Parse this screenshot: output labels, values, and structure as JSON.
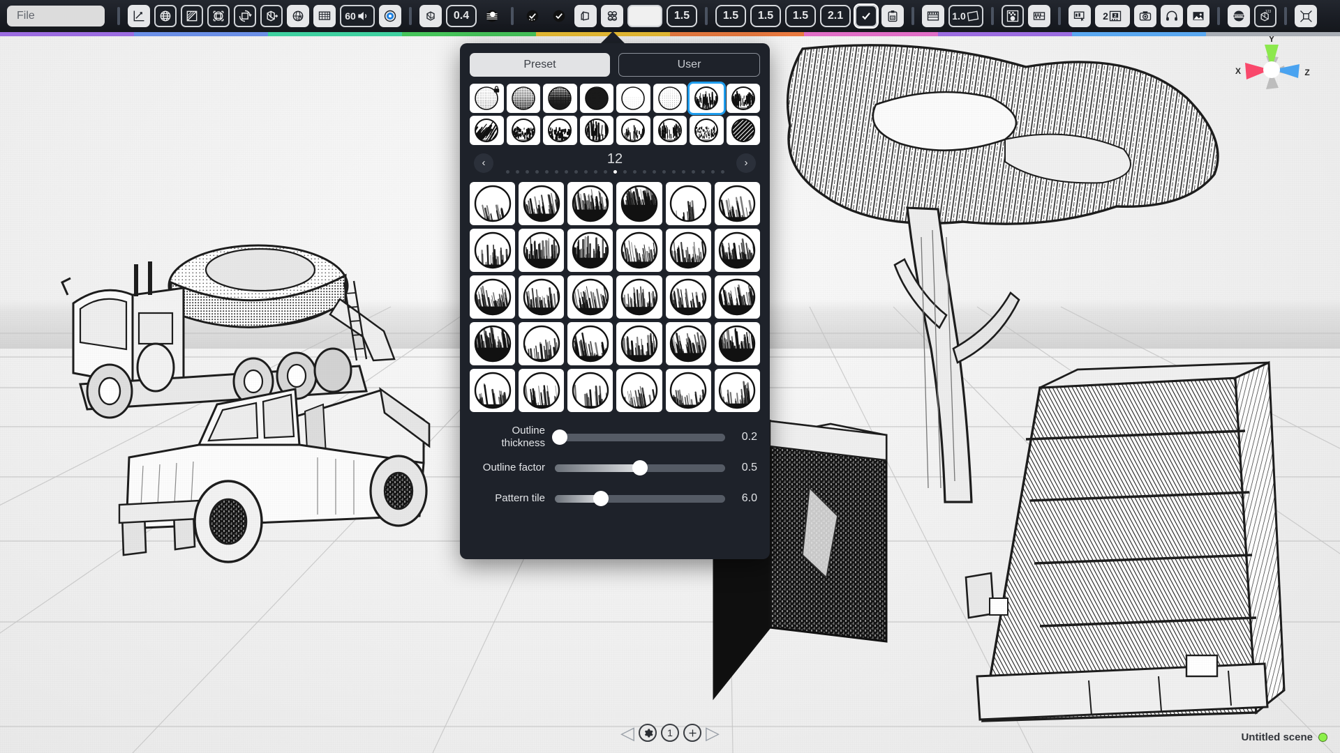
{
  "app": {
    "window_title": "Untitled scene",
    "scene_status_color": "#8cf04a"
  },
  "toolbar": {
    "file_field": {
      "name": "file-field",
      "value": "",
      "placeholder": "File"
    },
    "accent_strip_colors": [
      "#9b6ce0",
      "#6b8fe6",
      "#3fd0a0",
      "#46c45a",
      "#e8bb33",
      "#e8793f",
      "#e06ec6",
      "#9b6ce0",
      "#5aa8f0",
      "#a8adb4"
    ],
    "buttons": [
      {
        "name": "axes-tool-button",
        "icon": "axes-icon",
        "label": "",
        "style": "light"
      },
      {
        "name": "globe-wire-button",
        "icon": "globe-wire-icon",
        "label": "",
        "style": "dark"
      },
      {
        "name": "gradient-square-button",
        "icon": "gradient-square-icon",
        "label": "",
        "style": "dark"
      },
      {
        "name": "bounding-select-button",
        "icon": "bounding-select-icon",
        "label": "",
        "style": "dark"
      },
      {
        "name": "rotate-cube-button",
        "icon": "rotate-cube-icon",
        "label": "",
        "style": "dark"
      },
      {
        "name": "extrude-cube-button",
        "icon": "extrude-cube-icon",
        "label": "",
        "style": "dark"
      },
      {
        "name": "globe-button",
        "icon": "globe-icon",
        "label": "",
        "style": "light"
      },
      {
        "name": "grid-panel-button",
        "icon": "grid-panel-icon",
        "label": "",
        "style": "light"
      },
      {
        "name": "fps-speaker-button",
        "icon": "speaker-icon",
        "label": "60",
        "style": "dark"
      },
      {
        "name": "target-button",
        "icon": "target-icon",
        "label": "",
        "style": "light"
      },
      {
        "name": "cube-button",
        "icon": "cube-icon",
        "label": "",
        "style": "light"
      },
      {
        "name": "opacity-value-button",
        "icon": "",
        "label": "0.4",
        "style": "num"
      },
      {
        "name": "shading-sphere-button",
        "icon": "shading-sphere-icon",
        "label": "",
        "style": "plain"
      },
      {
        "name": "dither-check-button",
        "icon": "dither-check-icon",
        "label": "",
        "style": "plain"
      },
      {
        "name": "check-circle-button",
        "icon": "check-circle-icon",
        "label": "",
        "style": "plain"
      },
      {
        "name": "shape-skew-button",
        "icon": "shape-skew-icon",
        "label": "",
        "style": "light"
      },
      {
        "name": "four-spheres-button",
        "icon": "four-spheres-icon",
        "label": "",
        "style": "light"
      },
      {
        "name": "material-preview-button",
        "icon": "blank-preview-icon",
        "label": "",
        "style": "preview"
      },
      {
        "name": "value-a-button",
        "icon": "",
        "label": "1.5",
        "style": "num"
      },
      {
        "name": "value-b-button",
        "icon": "",
        "label": "1.5",
        "style": "num"
      },
      {
        "name": "value-c-button",
        "icon": "",
        "label": "1.5",
        "style": "num"
      },
      {
        "name": "value-d-button",
        "icon": "",
        "label": "1.5",
        "style": "num"
      },
      {
        "name": "value-e-button",
        "icon": "",
        "label": "2.1",
        "style": "num"
      },
      {
        "name": "confirm-check-button",
        "icon": "check-icon",
        "label": "",
        "style": "check"
      },
      {
        "name": "export-3d-button",
        "icon": "clipboard-3d-icon",
        "label": "",
        "style": "light"
      },
      {
        "name": "filmstrip-button",
        "icon": "filmstrip-icon",
        "label": "",
        "style": "light"
      },
      {
        "name": "zoom-value-button",
        "icon": "banner-icon",
        "label": "1.0",
        "style": "dark"
      },
      {
        "name": "checker-dot-button",
        "icon": "checker-dot-icon",
        "label": "",
        "style": "dark"
      },
      {
        "name": "timeline-button",
        "icon": "timeline-icon",
        "label": "",
        "style": "light"
      },
      {
        "name": "timeline-drag-button",
        "icon": "timeline-drag-icon",
        "label": "",
        "style": "light"
      },
      {
        "name": "frame-2-button",
        "icon": "frame-number-icon",
        "label": "2",
        "style": "light"
      },
      {
        "name": "camera-button",
        "icon": "camera-icon",
        "label": "",
        "style": "light"
      },
      {
        "name": "headphones-button",
        "icon": "headphones-icon",
        "label": "",
        "style": "light"
      },
      {
        "name": "image-button",
        "icon": "image-icon",
        "label": "",
        "style": "light"
      },
      {
        "name": "www-button",
        "icon": "www-globe-icon",
        "label": "",
        "style": "light"
      },
      {
        "name": "cube-123-button",
        "icon": "cube-123-icon",
        "label": "",
        "style": "dark"
      },
      {
        "name": "transform-gizmo-button",
        "icon": "transform-gizmo-icon",
        "label": "",
        "style": "light"
      }
    ]
  },
  "material_panel": {
    "tabs": [
      {
        "name": "tab-preset",
        "label": "Preset",
        "active": true
      },
      {
        "name": "tab-user",
        "label": "User",
        "active": false
      }
    ],
    "top_swatches": [
      {
        "name": "swatch-dot-fine",
        "pattern": "halftone-fine",
        "locked": true,
        "selected": false
      },
      {
        "name": "swatch-dot-medium",
        "pattern": "halftone-medium",
        "selected": false
      },
      {
        "name": "swatch-dot-dense",
        "pattern": "halftone-dense",
        "selected": false
      },
      {
        "name": "swatch-dot-heavy",
        "pattern": "halftone-heavy",
        "selected": false
      },
      {
        "name": "swatch-dot-light",
        "pattern": "halftone-light",
        "selected": false
      },
      {
        "name": "swatch-dot-sparse",
        "pattern": "halftone-sparse",
        "selected": false
      },
      {
        "name": "swatch-brush-grass",
        "pattern": "brush-grass",
        "selected": true
      },
      {
        "name": "swatch-brush-scratch",
        "pattern": "brush-scratch",
        "selected": false
      },
      {
        "name": "swatch-brush-slash",
        "pattern": "brush-slash",
        "selected": false
      },
      {
        "name": "swatch-brush-spatter",
        "pattern": "brush-spatter",
        "selected": false
      },
      {
        "name": "swatch-brush-dashes",
        "pattern": "brush-dashes",
        "selected": false
      },
      {
        "name": "swatch-brush-streak",
        "pattern": "brush-streak",
        "selected": false
      },
      {
        "name": "swatch-brush-wisp",
        "pattern": "brush-wisp",
        "selected": false
      },
      {
        "name": "swatch-brush-bristle",
        "pattern": "brush-bristle",
        "selected": false
      },
      {
        "name": "swatch-brush-gradient",
        "pattern": "brush-gradient",
        "selected": false
      },
      {
        "name": "swatch-diagonal-lines",
        "pattern": "diagonal-lines",
        "selected": false
      }
    ],
    "pager": {
      "prev_label": "‹",
      "next_label": "›",
      "current_page": "12",
      "total_dots": 23,
      "active_dot_index": 12
    },
    "main_swatches_rows": 5,
    "main_swatches_cols": 6,
    "main_swatches": [
      {
        "name": "material-swatch",
        "tone": 0.12,
        "angle": 78
      },
      {
        "name": "material-swatch",
        "tone": 0.42,
        "angle": 80
      },
      {
        "name": "material-swatch",
        "tone": 0.62,
        "angle": 82
      },
      {
        "name": "material-swatch",
        "tone": 0.85,
        "angle": 80
      },
      {
        "name": "material-swatch",
        "tone": 0.06,
        "angle": 85
      },
      {
        "name": "material-swatch",
        "tone": 0.26,
        "angle": 80
      },
      {
        "name": "material-swatch",
        "tone": 0.22,
        "angle": 88
      },
      {
        "name": "material-swatch",
        "tone": 0.5,
        "angle": 88
      },
      {
        "name": "material-swatch",
        "tone": 0.55,
        "angle": 90
      },
      {
        "name": "material-swatch",
        "tone": 0.36,
        "angle": 82
      },
      {
        "name": "material-swatch",
        "tone": 0.34,
        "angle": 84
      },
      {
        "name": "material-swatch",
        "tone": 0.48,
        "angle": 82
      },
      {
        "name": "material-swatch",
        "tone": 0.45,
        "angle": 80
      },
      {
        "name": "material-swatch",
        "tone": 0.4,
        "angle": 84
      },
      {
        "name": "material-swatch",
        "tone": 0.38,
        "angle": 80
      },
      {
        "name": "material-swatch",
        "tone": 0.43,
        "angle": 86
      },
      {
        "name": "material-swatch",
        "tone": 0.4,
        "angle": 82
      },
      {
        "name": "material-swatch",
        "tone": 0.52,
        "angle": 80
      },
      {
        "name": "material-swatch",
        "tone": 0.72,
        "angle": 82
      },
      {
        "name": "material-swatch",
        "tone": 0.18,
        "angle": 84
      },
      {
        "name": "material-swatch",
        "tone": 0.32,
        "angle": 80
      },
      {
        "name": "material-swatch",
        "tone": 0.36,
        "angle": 86
      },
      {
        "name": "material-swatch",
        "tone": 0.46,
        "angle": 80
      },
      {
        "name": "material-swatch",
        "tone": 0.68,
        "angle": 84
      },
      {
        "name": "material-swatch",
        "tone": 0.24,
        "angle": 82
      },
      {
        "name": "material-swatch",
        "tone": 0.2,
        "angle": 84
      },
      {
        "name": "material-swatch",
        "tone": 0.16,
        "angle": 86
      },
      {
        "name": "material-swatch",
        "tone": 0.14,
        "angle": 80
      },
      {
        "name": "material-swatch",
        "tone": 0.22,
        "angle": 82
      },
      {
        "name": "material-swatch",
        "tone": 0.28,
        "angle": 84
      }
    ],
    "sliders": [
      {
        "name": "slider-outline-thickness",
        "label": "Outline\nthickness",
        "label_line1": "Outline",
        "label_line2": "thickness",
        "value": "0.2",
        "percent": 3
      },
      {
        "name": "slider-outline-factor",
        "label": "Outline factor",
        "label_line1": "Outline factor",
        "label_line2": "",
        "value": "0.5",
        "percent": 50
      },
      {
        "name": "slider-pattern-tile",
        "label": "Pattern tile",
        "label_line1": "Pattern tile",
        "label_line2": "",
        "value": "6.0",
        "percent": 27
      }
    ]
  },
  "bottom_bar": {
    "prev_arrow": "◁",
    "next_arrow": "▷",
    "settings_icon": "gear-icon",
    "page_number": "1",
    "add_label": "+"
  },
  "gizmo": {
    "x_label": "X",
    "y_label": "Y",
    "z_label": "Z",
    "x_color": "#f9486b",
    "y_color": "#8ce84e",
    "z_color": "#4aa3f0"
  }
}
